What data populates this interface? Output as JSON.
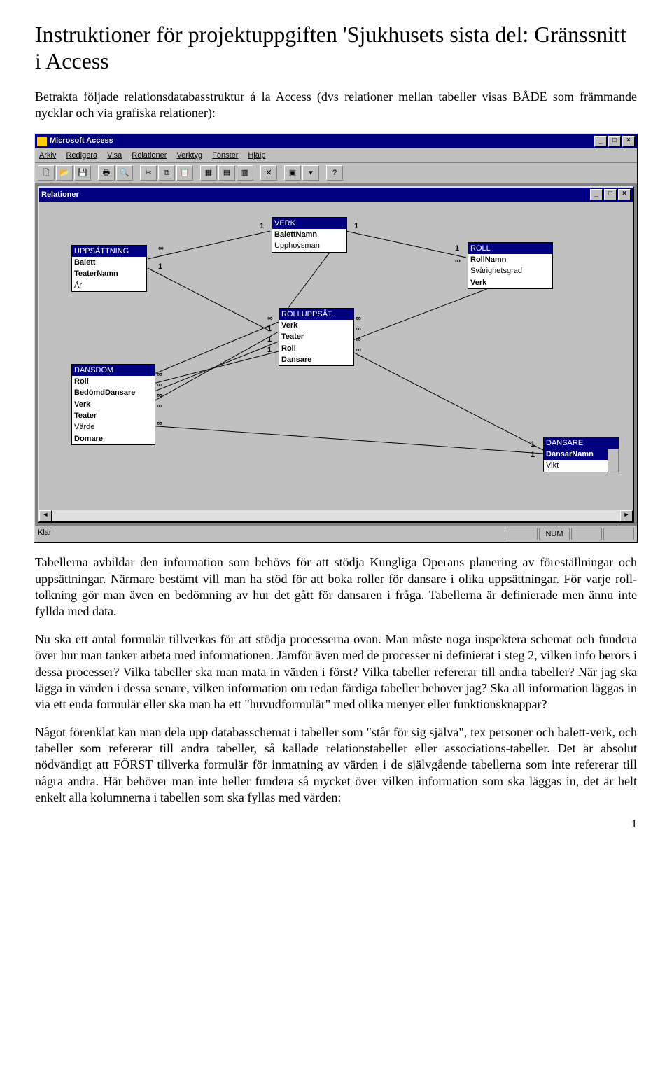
{
  "title": "Instruktioner för projektuppgiften 'Sjukhusets sista del: Gränssnitt i Access",
  "paragraphs": {
    "p1": "Betrakta följade relationsdatabasstruktur á la Access (dvs relationer mellan tabeller visas BÅDE som främmande nycklar och via grafiska relationer):",
    "p2": "Tabellerna avbildar den information som behövs för att stödja Kungliga Operans planering av föreställningar och uppsättningar. Närmare bestämt vill man ha stöd för att boka roller för dansare i olika uppsättningar. För varje roll-tolkning gör man även en bedömning av hur det gått för dansaren i fråga. Tabellerna är definierade men ännu inte fyllda med data.",
    "p3": "Nu ska ett antal formulär tillverkas för att stödja processerna ovan. Man måste noga inspektera schemat och fundera över hur man tänker arbeta med informationen. Jämför även med de processer ni definierat i steg 2, vilken info berörs i dessa processer? Vilka tabeller ska man mata in värden i först? Vilka tabeller refererar till andra tabeller? När jag ska lägga in värden i dessa senare, vilken information om redan färdiga tabeller behöver jag? Ska all information läggas in via ett enda formulär eller ska man ha ett \"huvudformulär\" med olika menyer eller funktionsknappar?",
    "p4": "Något förenklat kan man dela upp databasschemat i tabeller som \"står för sig själva\", tex personer och balett-verk, och tabeller som refererar till andra tabeller, så kallade relationstabeller eller associations-tabeller. Det är absolut nödvändigt att FÖRST tillverka formulär för inmatning av värden i de självgående tabellerna som inte refererar till några andra. Här  behöver man inte heller fundera så mycket över vilken information som ska läggas in, det är helt enkelt alla kolumnerna i tabellen som ska fyllas med värden:"
  },
  "page_number": "1",
  "access": {
    "app_title": "Microsoft Access",
    "menu": [
      "Arkiv",
      "Redigera",
      "Visa",
      "Relationer",
      "Verktyg",
      "Fönster",
      "Hjälp"
    ],
    "child_title": "Relationer",
    "status_ready": "Klar",
    "status_num": "NUM",
    "tables": {
      "uppsattning": {
        "name": "UPPSÄTTNING",
        "fields": [
          "Balett",
          "TeaterNamn",
          "År"
        ]
      },
      "verk": {
        "name": "VERK",
        "fields": [
          "BalettNamn",
          "Upphovsman"
        ]
      },
      "roll": {
        "name": "ROLL",
        "fields": [
          "RollNamn",
          "Svårighetsgrad",
          "Verk"
        ]
      },
      "rolluppsat": {
        "name": "ROLLUPPSÄT..",
        "fields": [
          "Verk",
          "Teater",
          "Roll",
          "Dansare"
        ]
      },
      "dansdom": {
        "name": "DANSDOM",
        "fields": [
          "Roll",
          "BedömdDansare",
          "Verk",
          "Teater",
          "Värde",
          "Domare"
        ]
      },
      "dansare": {
        "name": "DANSARE",
        "fields": [
          "DansarNamn",
          "Vikt"
        ]
      }
    },
    "cardinality": {
      "one": "1",
      "many": "∞"
    }
  }
}
